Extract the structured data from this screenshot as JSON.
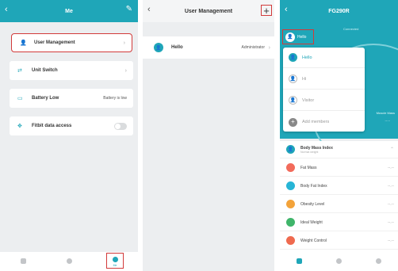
{
  "screen1": {
    "title": "Me",
    "items": [
      {
        "label": "User Management",
        "value": "",
        "icon": "user-icon"
      },
      {
        "label": "Unit Switch",
        "value": "",
        "icon": "switch-arrows-icon"
      },
      {
        "label": "Battery Low",
        "value": "Battery is low",
        "icon": "battery-icon"
      },
      {
        "label": "Fitbit data access",
        "value": "",
        "icon": "fitbit-icon"
      }
    ],
    "tabs": [
      {
        "label": "",
        "icon": "device-icon"
      },
      {
        "label": "",
        "icon": "record-icon"
      },
      {
        "label": "Me",
        "icon": "profile-icon"
      }
    ]
  },
  "screen2": {
    "title": "User Management",
    "user": {
      "name": "Hello",
      "role": "Administrator"
    }
  },
  "screen3": {
    "title": "FG290R",
    "status": "Connected",
    "current_user": "Hello",
    "menu": [
      "Hello",
      "Hi",
      "Visitor",
      "Add members"
    ],
    "muscle_label": "Muscle Mass",
    "muscle_value": "--.--",
    "bmi": {
      "label": "Body Mass Index",
      "sub": "Normal weight"
    },
    "metrics": [
      {
        "label": "Fat Mass",
        "value": "--.--",
        "color": "#f26b5b"
      },
      {
        "label": "Body Fat Index",
        "value": "--.--",
        "color": "#27b5d6"
      },
      {
        "label": "Obesity Level",
        "value": "--.--",
        "color": "#f3a33a"
      },
      {
        "label": "Ideal Weight",
        "value": "--.--",
        "color": "#3fb56a"
      },
      {
        "label": "Weight Control",
        "value": "--.--",
        "color": "#ef6a4f"
      }
    ],
    "tabs": [
      {
        "label": "",
        "icon": "device-icon"
      },
      {
        "label": "",
        "icon": "record-icon"
      },
      {
        "label": "",
        "icon": "profile-icon"
      }
    ]
  },
  "colors": {
    "accent": "#1fa6b8",
    "highlight": "#d23a3a"
  }
}
